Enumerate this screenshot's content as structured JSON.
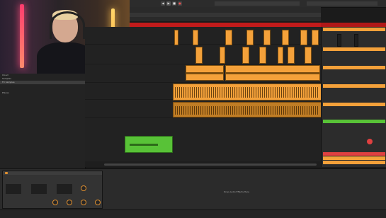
{
  "browser": {
    "items": [
      {
        "label": "Cloud",
        "selected": false
      },
      {
        "label": "Samples",
        "selected": false
      },
      {
        "label": "FX Samples",
        "selected": true
      },
      {
        "label": "",
        "selected": false
      },
      {
        "label": "",
        "selected": false
      },
      {
        "label": "Places",
        "selected": false
      },
      {
        "label": "",
        "selected": false
      },
      {
        "label": "",
        "selected": false
      },
      {
        "label": "",
        "selected": false
      },
      {
        "label": "",
        "selected": false
      },
      {
        "label": "",
        "selected": false
      },
      {
        "label": "",
        "selected": false
      },
      {
        "label": "",
        "selected": false
      },
      {
        "label": "",
        "selected": false
      },
      {
        "label": "",
        "selected": false
      },
      {
        "label": "",
        "selected": false
      },
      {
        "label": "",
        "selected": false
      },
      {
        "label": "",
        "selected": false
      },
      {
        "label": "",
        "selected": false
      }
    ]
  },
  "colors": {
    "clip_orange": "#f4a13a",
    "clip_green": "#58c237",
    "record_red": "#c21b1b"
  },
  "devices": {
    "drop_hint": "Drop Audio Effects Here"
  },
  "icons": {
    "transport": [
      "rewind-icon",
      "play-icon",
      "stop-icon",
      "record-icon"
    ]
  }
}
